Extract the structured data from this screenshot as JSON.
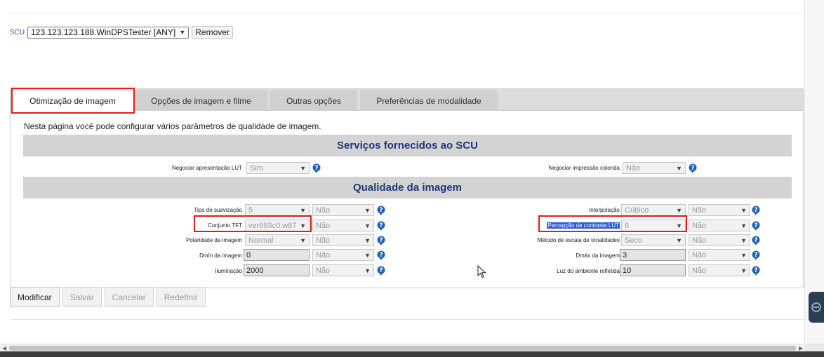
{
  "scu": {
    "label": "SCU",
    "selected": "123.123.123.188.WinDPSTester [ANY]",
    "remove_label": "Remover"
  },
  "tabs": [
    {
      "label": "Otimização de imagem",
      "active": true
    },
    {
      "label": "Opções de imagem e filme",
      "active": false
    },
    {
      "label": "Outras opções",
      "active": false
    },
    {
      "label": "Preferências de modalidade",
      "active": false
    }
  ],
  "intro": "Nesta página você pode configurar vários parâmetros de qualidade de imagem.",
  "services": {
    "title": "Serviços fornecidos ao SCU",
    "negotiate_lut": {
      "label": "Negociar apresentação LUT",
      "value": "Sim"
    },
    "negotiate_color": {
      "label": "Negociar impressão colorida",
      "value": "Não"
    }
  },
  "quality": {
    "title": "Qualidade da imagem",
    "left": [
      {
        "label": "Tipo de suavização",
        "value": "5",
        "kind": "select",
        "flag": "Não"
      },
      {
        "label": "Conjunto TFT",
        "value": "ver693c0.w87",
        "kind": "select",
        "flag": "Não"
      },
      {
        "label": "Polaridade da imagem",
        "value": "Normal",
        "kind": "select",
        "flag": "Não"
      },
      {
        "label": "Dmín da imagem",
        "value": "0",
        "kind": "input",
        "flag": "Não"
      },
      {
        "label": "Iluminação",
        "value": "2000",
        "kind": "input",
        "flag": "Não"
      }
    ],
    "right": [
      {
        "label": "Interpolação",
        "value": "Cúbico",
        "kind": "select",
        "flag": "Não"
      },
      {
        "label": "Percepção de contraste LUT",
        "value": "6",
        "kind": "select",
        "flag": "Não"
      },
      {
        "label": "Método de escala de tonalidades",
        "value": "Seco",
        "kind": "select",
        "flag": "Não"
      },
      {
        "label": "Dmáx da imagem",
        "value": "3",
        "kind": "input",
        "flag": "Não"
      },
      {
        "label": "Luz do ambiente refletida",
        "value": "10",
        "kind": "input",
        "flag": "Não"
      }
    ]
  },
  "actions": {
    "modify": "Modificar",
    "save": "Salvar",
    "cancel": "Cancelar",
    "reset": "Redefinir"
  },
  "icons": {
    "help": "help-icon",
    "chevron": "chevron-down-icon",
    "cursor": "mouse-pointer-icon"
  },
  "colors": {
    "section_title": "#1f3a7a",
    "highlight_box": "#e01b1b",
    "selection": "#2b5bd7"
  }
}
